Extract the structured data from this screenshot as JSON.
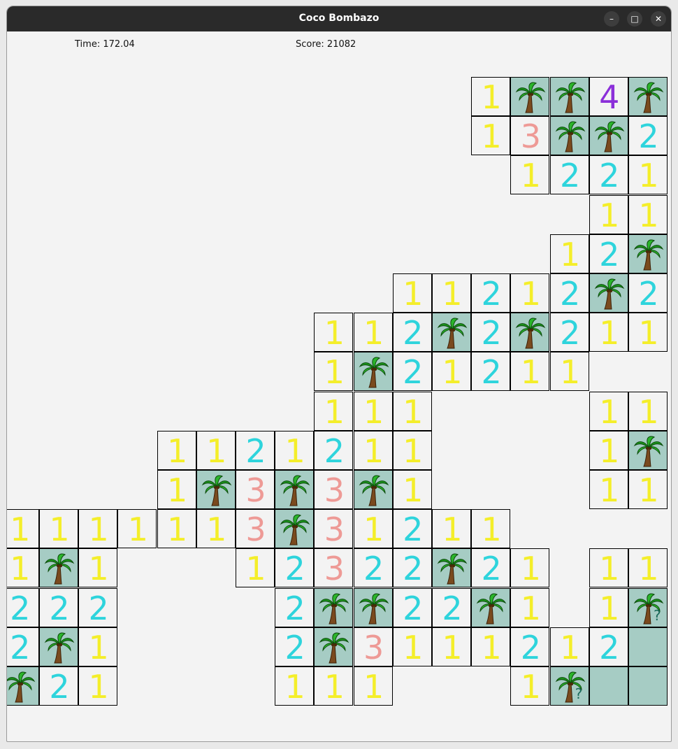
{
  "window": {
    "title": "Coco Bombazo",
    "controls": {
      "minimize": "–",
      "maximize": "□",
      "close": "✕"
    }
  },
  "hud": {
    "time_label": "Time: 172.04",
    "score_label": "Score: 21082"
  },
  "board": {
    "legend": {
      "palm": "revealed-coconut-tree",
      "palm_q": "coconut-tree-question-mark",
      "empty": "covered-cell",
      "number": "adjacent-tree-count"
    },
    "colors": {
      "1": "#f4ee2a",
      "2": "#2ed4dc",
      "3": "#ee9a96",
      "4": "#8b2fd9",
      "palm_bg": "#a6ccc4"
    },
    "question_mark": "?",
    "cells": [
      {
        "c": 11,
        "r": 0,
        "v": "1"
      },
      {
        "c": 12,
        "r": 0,
        "v": "P"
      },
      {
        "c": 13,
        "r": 0,
        "v": "P"
      },
      {
        "c": 14,
        "r": 0,
        "v": "4"
      },
      {
        "c": 15,
        "r": 0,
        "v": "P"
      },
      {
        "c": 11,
        "r": 1,
        "v": "1"
      },
      {
        "c": 12,
        "r": 1,
        "v": "3"
      },
      {
        "c": 13,
        "r": 1,
        "v": "P"
      },
      {
        "c": 14,
        "r": 1,
        "v": "P"
      },
      {
        "c": 15,
        "r": 1,
        "v": "2"
      },
      {
        "c": 12,
        "r": 2,
        "v": "1"
      },
      {
        "c": 13,
        "r": 2,
        "v": "2"
      },
      {
        "c": 14,
        "r": 2,
        "v": "2"
      },
      {
        "c": 15,
        "r": 2,
        "v": "1"
      },
      {
        "c": 14,
        "r": 3,
        "v": "1"
      },
      {
        "c": 15,
        "r": 3,
        "v": "1"
      },
      {
        "c": 13,
        "r": 4,
        "v": "1"
      },
      {
        "c": 14,
        "r": 4,
        "v": "2"
      },
      {
        "c": 15,
        "r": 4,
        "v": "P"
      },
      {
        "c": 9,
        "r": 5,
        "v": "1"
      },
      {
        "c": 10,
        "r": 5,
        "v": "1"
      },
      {
        "c": 11,
        "r": 5,
        "v": "2"
      },
      {
        "c": 12,
        "r": 5,
        "v": "1"
      },
      {
        "c": 13,
        "r": 5,
        "v": "2"
      },
      {
        "c": 14,
        "r": 5,
        "v": "P"
      },
      {
        "c": 15,
        "r": 5,
        "v": "2"
      },
      {
        "c": 7,
        "r": 6,
        "v": "1"
      },
      {
        "c": 8,
        "r": 6,
        "v": "1"
      },
      {
        "c": 9,
        "r": 6,
        "v": "2"
      },
      {
        "c": 10,
        "r": 6,
        "v": "P"
      },
      {
        "c": 11,
        "r": 6,
        "v": "2"
      },
      {
        "c": 12,
        "r": 6,
        "v": "P"
      },
      {
        "c": 13,
        "r": 6,
        "v": "2"
      },
      {
        "c": 14,
        "r": 6,
        "v": "1"
      },
      {
        "c": 15,
        "r": 6,
        "v": "1"
      },
      {
        "c": 7,
        "r": 7,
        "v": "1"
      },
      {
        "c": 8,
        "r": 7,
        "v": "P"
      },
      {
        "c": 9,
        "r": 7,
        "v": "2"
      },
      {
        "c": 10,
        "r": 7,
        "v": "1"
      },
      {
        "c": 11,
        "r": 7,
        "v": "2"
      },
      {
        "c": 12,
        "r": 7,
        "v": "1"
      },
      {
        "c": 13,
        "r": 7,
        "v": "1"
      },
      {
        "c": 7,
        "r": 8,
        "v": "1"
      },
      {
        "c": 8,
        "r": 8,
        "v": "1"
      },
      {
        "c": 9,
        "r": 8,
        "v": "1"
      },
      {
        "c": 14,
        "r": 8,
        "v": "1"
      },
      {
        "c": 15,
        "r": 8,
        "v": "1"
      },
      {
        "c": 3,
        "r": 9,
        "v": "1"
      },
      {
        "c": 4,
        "r": 9,
        "v": "1"
      },
      {
        "c": 5,
        "r": 9,
        "v": "2"
      },
      {
        "c": 6,
        "r": 9,
        "v": "1"
      },
      {
        "c": 7,
        "r": 9,
        "v": "2"
      },
      {
        "c": 8,
        "r": 9,
        "v": "1"
      },
      {
        "c": 9,
        "r": 9,
        "v": "1"
      },
      {
        "c": 14,
        "r": 9,
        "v": "1"
      },
      {
        "c": 15,
        "r": 9,
        "v": "P"
      },
      {
        "c": 3,
        "r": 10,
        "v": "1"
      },
      {
        "c": 4,
        "r": 10,
        "v": "P"
      },
      {
        "c": 5,
        "r": 10,
        "v": "3"
      },
      {
        "c": 6,
        "r": 10,
        "v": "P"
      },
      {
        "c": 7,
        "r": 10,
        "v": "3"
      },
      {
        "c": 8,
        "r": 10,
        "v": "P"
      },
      {
        "c": 9,
        "r": 10,
        "v": "1"
      },
      {
        "c": 14,
        "r": 10,
        "v": "1"
      },
      {
        "c": 15,
        "r": 10,
        "v": "1"
      },
      {
        "c": -1,
        "r": 11,
        "v": "1"
      },
      {
        "c": 0,
        "r": 11,
        "v": "1"
      },
      {
        "c": 1,
        "r": 11,
        "v": "1"
      },
      {
        "c": 2,
        "r": 11,
        "v": "1"
      },
      {
        "c": 3,
        "r": 11,
        "v": "1"
      },
      {
        "c": 4,
        "r": 11,
        "v": "1"
      },
      {
        "c": 5,
        "r": 11,
        "v": "3"
      },
      {
        "c": 6,
        "r": 11,
        "v": "P"
      },
      {
        "c": 7,
        "r": 11,
        "v": "3"
      },
      {
        "c": 8,
        "r": 11,
        "v": "1"
      },
      {
        "c": 9,
        "r": 11,
        "v": "2"
      },
      {
        "c": 10,
        "r": 11,
        "v": "1"
      },
      {
        "c": 11,
        "r": 11,
        "v": "1"
      },
      {
        "c": -1,
        "r": 12,
        "v": "1"
      },
      {
        "c": 0,
        "r": 12,
        "v": "P"
      },
      {
        "c": 1,
        "r": 12,
        "v": "1"
      },
      {
        "c": 5,
        "r": 12,
        "v": "1"
      },
      {
        "c": 6,
        "r": 12,
        "v": "2"
      },
      {
        "c": 7,
        "r": 12,
        "v": "3"
      },
      {
        "c": 8,
        "r": 12,
        "v": "2"
      },
      {
        "c": 9,
        "r": 12,
        "v": "2"
      },
      {
        "c": 10,
        "r": 12,
        "v": "P"
      },
      {
        "c": 11,
        "r": 12,
        "v": "2"
      },
      {
        "c": 12,
        "r": 12,
        "v": "1"
      },
      {
        "c": 14,
        "r": 12,
        "v": "1"
      },
      {
        "c": 15,
        "r": 12,
        "v": "1"
      },
      {
        "c": -1,
        "r": 13,
        "v": "2"
      },
      {
        "c": 0,
        "r": 13,
        "v": "2"
      },
      {
        "c": 1,
        "r": 13,
        "v": "2"
      },
      {
        "c": 6,
        "r": 13,
        "v": "2"
      },
      {
        "c": 7,
        "r": 13,
        "v": "P"
      },
      {
        "c": 8,
        "r": 13,
        "v": "P"
      },
      {
        "c": 9,
        "r": 13,
        "v": "2"
      },
      {
        "c": 10,
        "r": 13,
        "v": "2"
      },
      {
        "c": 11,
        "r": 13,
        "v": "P"
      },
      {
        "c": 12,
        "r": 13,
        "v": "1"
      },
      {
        "c": 14,
        "r": 13,
        "v": "1"
      },
      {
        "c": 15,
        "r": 13,
        "v": "PQ"
      },
      {
        "c": -1,
        "r": 14,
        "v": "2"
      },
      {
        "c": 0,
        "r": 14,
        "v": "P"
      },
      {
        "c": 1,
        "r": 14,
        "v": "1"
      },
      {
        "c": 6,
        "r": 14,
        "v": "2"
      },
      {
        "c": 7,
        "r": 14,
        "v": "P"
      },
      {
        "c": 8,
        "r": 14,
        "v": "3"
      },
      {
        "c": 9,
        "r": 14,
        "v": "1"
      },
      {
        "c": 10,
        "r": 14,
        "v": "1"
      },
      {
        "c": 11,
        "r": 14,
        "v": "1"
      },
      {
        "c": 12,
        "r": 14,
        "v": "2"
      },
      {
        "c": 13,
        "r": 14,
        "v": "1"
      },
      {
        "c": 14,
        "r": 14,
        "v": "2"
      },
      {
        "c": 15,
        "r": 14,
        "v": "E"
      },
      {
        "c": -1,
        "r": 15,
        "v": "P"
      },
      {
        "c": 0,
        "r": 15,
        "v": "2"
      },
      {
        "c": 1,
        "r": 15,
        "v": "1"
      },
      {
        "c": 6,
        "r": 15,
        "v": "1"
      },
      {
        "c": 7,
        "r": 15,
        "v": "1"
      },
      {
        "c": 8,
        "r": 15,
        "v": "1"
      },
      {
        "c": 12,
        "r": 15,
        "v": "1"
      },
      {
        "c": 13,
        "r": 15,
        "v": "PQ"
      },
      {
        "c": 14,
        "r": 15,
        "v": "E"
      },
      {
        "c": 15,
        "r": 15,
        "v": "E"
      }
    ]
  }
}
